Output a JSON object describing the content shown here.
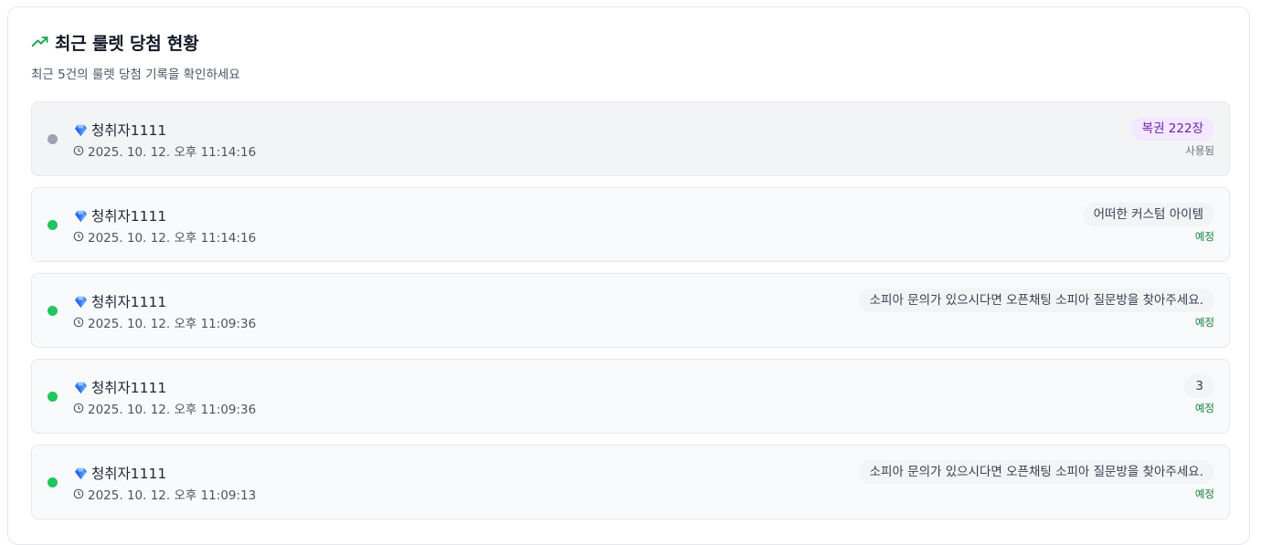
{
  "header": {
    "trend_icon": "trending-up-icon",
    "title": "최근 룰렛 당첨 현황",
    "subtitle": "최근 5건의 룰렛 당첨 기록을 확인하세요"
  },
  "colors": {
    "accent_green": "#16a34a",
    "status_dot_active": "#22c55e",
    "status_dot_used": "#9ca3af",
    "badge_purple_bg": "#f3e8ff",
    "badge_purple_text": "#6b21a8",
    "status_scheduled": "#15803d",
    "status_used": "#6b7280"
  },
  "entries": [
    {
      "gem_icon": "gem-icon",
      "username": "청취자1111",
      "time": "2025. 10. 12. 오후 11:14:16",
      "prize": "복권 222장",
      "status": "사용됨",
      "used": true
    },
    {
      "gem_icon": "gem-icon",
      "username": "청취자1111",
      "time": "2025. 10. 12. 오후 11:14:16",
      "prize": "어떠한 커스텀 아이템",
      "status": "예정",
      "used": false
    },
    {
      "gem_icon": "gem-icon",
      "username": "청취자1111",
      "time": "2025. 10. 12. 오후 11:09:36",
      "prize": "소피아 문의가 있으시다면 오픈채팅 소피아 질문방을 찾아주세요.",
      "status": "예정",
      "used": false
    },
    {
      "gem_icon": "gem-icon",
      "username": "청취자1111",
      "time": "2025. 10. 12. 오후 11:09:36",
      "prize": "3",
      "status": "예정",
      "used": false
    },
    {
      "gem_icon": "gem-icon",
      "username": "청취자1111",
      "time": "2025. 10. 12. 오후 11:09:13",
      "prize": "소피아 문의가 있으시다면 오픈채팅 소피아 질문방을 찾아주세요.",
      "status": "예정",
      "used": false
    }
  ]
}
